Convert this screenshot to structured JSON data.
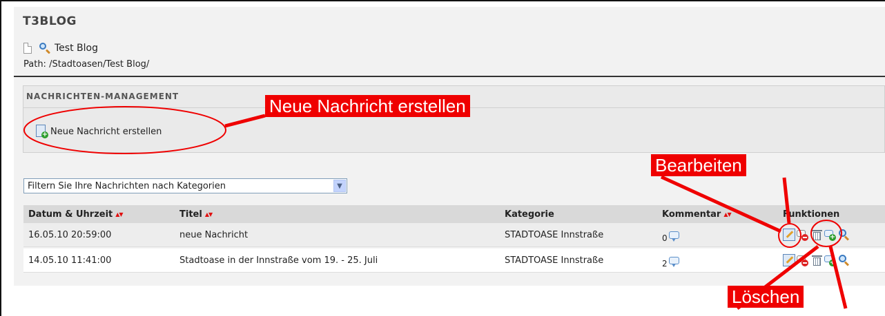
{
  "app": {
    "title": "T3BLOG"
  },
  "blog": {
    "name": "Test Blog",
    "path": "Path: /Stadtoasen/Test Blog/"
  },
  "section": {
    "title": "NACHRICHTEN-MANAGEMENT",
    "new_button_label": "Neue Nachricht erstellen"
  },
  "filter": {
    "selected": "Filtern Sie Ihre Nachrichten nach Kategorien"
  },
  "table": {
    "columns": [
      "Datum & Uhrzeit",
      "Titel",
      "Kategorie",
      "Kommentar",
      "Funktionen"
    ],
    "rows": [
      {
        "date": "16.05.10 20:59:00",
        "title": "neue Nachricht",
        "category": "STADTOASE Innstraße",
        "comments": "0"
      },
      {
        "date": "14.05.10 11:41:00",
        "title": "Stadtoase in der Innstraße vom 19. - 25. Juli",
        "category": "STADTOASE Innstraße",
        "comments": "2"
      }
    ]
  },
  "annotations": {
    "new_message": "Neue Nachricht erstellen",
    "edit": "Bearbeiten",
    "delete": "Löschen",
    "color": "#ef0000"
  },
  "icons": [
    "page-icon",
    "zoom-icon",
    "new-document-icon",
    "chevron-down-icon",
    "sort-arrows-icon",
    "comment-bubble-icon",
    "edit-icon",
    "delete-comment-icon",
    "trash-icon",
    "add-comment-icon",
    "view-icon"
  ]
}
